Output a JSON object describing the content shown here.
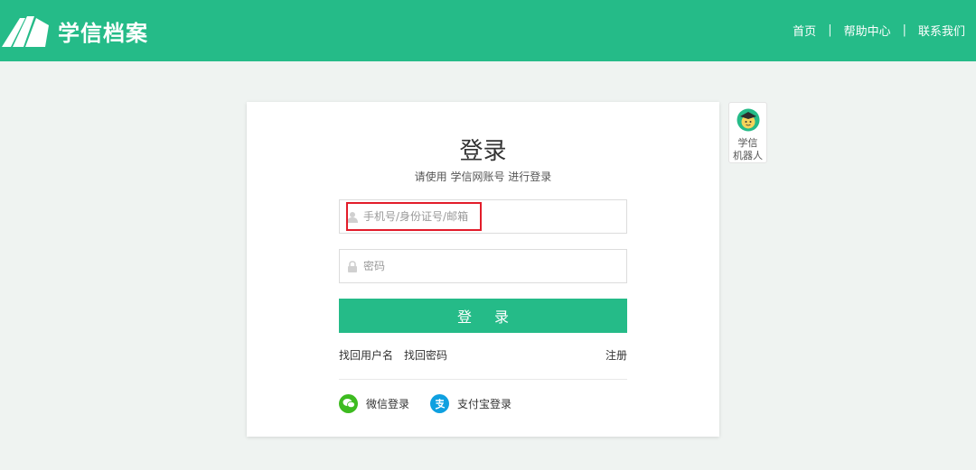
{
  "header": {
    "logo_text": "学信档案",
    "nav": [
      {
        "label": "首页"
      },
      {
        "label": "帮助中心"
      },
      {
        "label": "联系我们"
      }
    ],
    "separator": "|"
  },
  "login": {
    "title": "登录",
    "subtitle": "请使用 学信网账号 进行登录",
    "username_placeholder": "手机号/身份证号/邮箱",
    "password_placeholder": "密码",
    "submit_label": "登 录",
    "find_username": "找回用户名",
    "find_password": "找回密码",
    "register": "注册",
    "wechat_login": "微信登录",
    "alipay_login": "支付宝登录"
  },
  "robot": {
    "line1": "学信",
    "line2": "机器人"
  },
  "colors": {
    "brand": "#25bb88",
    "highlight": "#e21c2a",
    "wechat": "#3dbb20",
    "alipay": "#0fa0e0"
  }
}
